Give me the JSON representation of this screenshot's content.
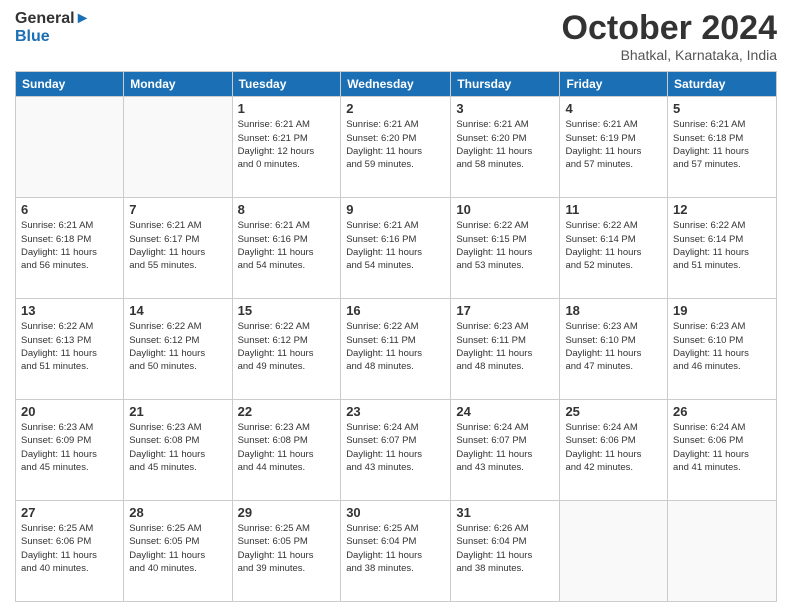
{
  "header": {
    "logo_line1": "General",
    "logo_line2": "Blue",
    "month": "October 2024",
    "location": "Bhatkal, Karnataka, India"
  },
  "days_of_week": [
    "Sunday",
    "Monday",
    "Tuesday",
    "Wednesday",
    "Thursday",
    "Friday",
    "Saturday"
  ],
  "weeks": [
    [
      {
        "day": "",
        "info": ""
      },
      {
        "day": "",
        "info": ""
      },
      {
        "day": "1",
        "info": "Sunrise: 6:21 AM\nSunset: 6:21 PM\nDaylight: 12 hours\nand 0 minutes."
      },
      {
        "day": "2",
        "info": "Sunrise: 6:21 AM\nSunset: 6:20 PM\nDaylight: 11 hours\nand 59 minutes."
      },
      {
        "day": "3",
        "info": "Sunrise: 6:21 AM\nSunset: 6:20 PM\nDaylight: 11 hours\nand 58 minutes."
      },
      {
        "day": "4",
        "info": "Sunrise: 6:21 AM\nSunset: 6:19 PM\nDaylight: 11 hours\nand 57 minutes."
      },
      {
        "day": "5",
        "info": "Sunrise: 6:21 AM\nSunset: 6:18 PM\nDaylight: 11 hours\nand 57 minutes."
      }
    ],
    [
      {
        "day": "6",
        "info": "Sunrise: 6:21 AM\nSunset: 6:18 PM\nDaylight: 11 hours\nand 56 minutes."
      },
      {
        "day": "7",
        "info": "Sunrise: 6:21 AM\nSunset: 6:17 PM\nDaylight: 11 hours\nand 55 minutes."
      },
      {
        "day": "8",
        "info": "Sunrise: 6:21 AM\nSunset: 6:16 PM\nDaylight: 11 hours\nand 54 minutes."
      },
      {
        "day": "9",
        "info": "Sunrise: 6:21 AM\nSunset: 6:16 PM\nDaylight: 11 hours\nand 54 minutes."
      },
      {
        "day": "10",
        "info": "Sunrise: 6:22 AM\nSunset: 6:15 PM\nDaylight: 11 hours\nand 53 minutes."
      },
      {
        "day": "11",
        "info": "Sunrise: 6:22 AM\nSunset: 6:14 PM\nDaylight: 11 hours\nand 52 minutes."
      },
      {
        "day": "12",
        "info": "Sunrise: 6:22 AM\nSunset: 6:14 PM\nDaylight: 11 hours\nand 51 minutes."
      }
    ],
    [
      {
        "day": "13",
        "info": "Sunrise: 6:22 AM\nSunset: 6:13 PM\nDaylight: 11 hours\nand 51 minutes."
      },
      {
        "day": "14",
        "info": "Sunrise: 6:22 AM\nSunset: 6:12 PM\nDaylight: 11 hours\nand 50 minutes."
      },
      {
        "day": "15",
        "info": "Sunrise: 6:22 AM\nSunset: 6:12 PM\nDaylight: 11 hours\nand 49 minutes."
      },
      {
        "day": "16",
        "info": "Sunrise: 6:22 AM\nSunset: 6:11 PM\nDaylight: 11 hours\nand 48 minutes."
      },
      {
        "day": "17",
        "info": "Sunrise: 6:23 AM\nSunset: 6:11 PM\nDaylight: 11 hours\nand 48 minutes."
      },
      {
        "day": "18",
        "info": "Sunrise: 6:23 AM\nSunset: 6:10 PM\nDaylight: 11 hours\nand 47 minutes."
      },
      {
        "day": "19",
        "info": "Sunrise: 6:23 AM\nSunset: 6:10 PM\nDaylight: 11 hours\nand 46 minutes."
      }
    ],
    [
      {
        "day": "20",
        "info": "Sunrise: 6:23 AM\nSunset: 6:09 PM\nDaylight: 11 hours\nand 45 minutes."
      },
      {
        "day": "21",
        "info": "Sunrise: 6:23 AM\nSunset: 6:08 PM\nDaylight: 11 hours\nand 45 minutes."
      },
      {
        "day": "22",
        "info": "Sunrise: 6:23 AM\nSunset: 6:08 PM\nDaylight: 11 hours\nand 44 minutes."
      },
      {
        "day": "23",
        "info": "Sunrise: 6:24 AM\nSunset: 6:07 PM\nDaylight: 11 hours\nand 43 minutes."
      },
      {
        "day": "24",
        "info": "Sunrise: 6:24 AM\nSunset: 6:07 PM\nDaylight: 11 hours\nand 43 minutes."
      },
      {
        "day": "25",
        "info": "Sunrise: 6:24 AM\nSunset: 6:06 PM\nDaylight: 11 hours\nand 42 minutes."
      },
      {
        "day": "26",
        "info": "Sunrise: 6:24 AM\nSunset: 6:06 PM\nDaylight: 11 hours\nand 41 minutes."
      }
    ],
    [
      {
        "day": "27",
        "info": "Sunrise: 6:25 AM\nSunset: 6:06 PM\nDaylight: 11 hours\nand 40 minutes."
      },
      {
        "day": "28",
        "info": "Sunrise: 6:25 AM\nSunset: 6:05 PM\nDaylight: 11 hours\nand 40 minutes."
      },
      {
        "day": "29",
        "info": "Sunrise: 6:25 AM\nSunset: 6:05 PM\nDaylight: 11 hours\nand 39 minutes."
      },
      {
        "day": "30",
        "info": "Sunrise: 6:25 AM\nSunset: 6:04 PM\nDaylight: 11 hours\nand 38 minutes."
      },
      {
        "day": "31",
        "info": "Sunrise: 6:26 AM\nSunset: 6:04 PM\nDaylight: 11 hours\nand 38 minutes."
      },
      {
        "day": "",
        "info": ""
      },
      {
        "day": "",
        "info": ""
      }
    ]
  ]
}
